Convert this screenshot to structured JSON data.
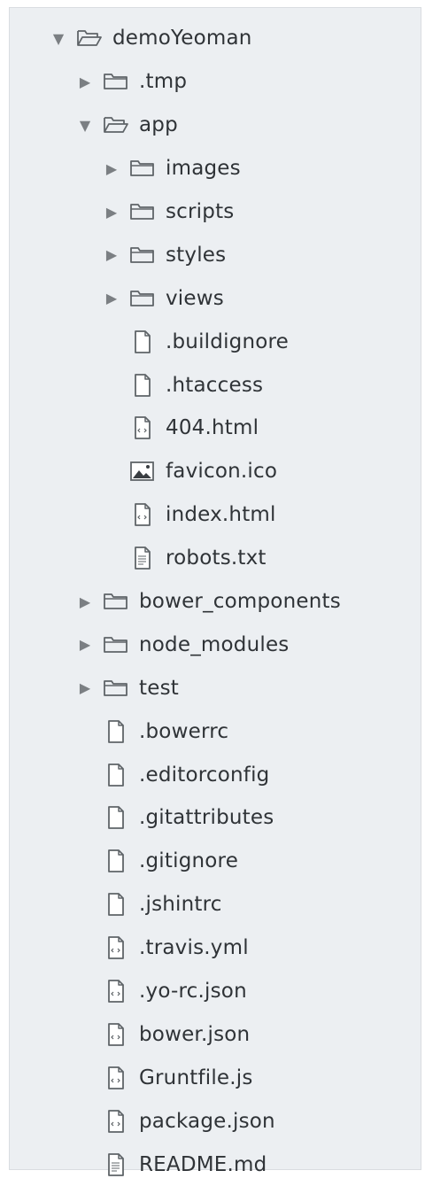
{
  "tree": [
    {
      "label": "demoYeoman",
      "kind": "folder",
      "state": "expanded",
      "depth": 0
    },
    {
      "label": ".tmp",
      "kind": "folder",
      "state": "collapsed",
      "depth": 1
    },
    {
      "label": "app",
      "kind": "folder",
      "state": "expanded",
      "depth": 1
    },
    {
      "label": "images",
      "kind": "folder",
      "state": "collapsed",
      "depth": 2
    },
    {
      "label": "scripts",
      "kind": "folder",
      "state": "collapsed",
      "depth": 2
    },
    {
      "label": "styles",
      "kind": "folder",
      "state": "collapsed",
      "depth": 2
    },
    {
      "label": "views",
      "kind": "folder",
      "state": "collapsed",
      "depth": 2
    },
    {
      "label": ".buildignore",
      "kind": "file",
      "icon": "file-icon",
      "depth": 2
    },
    {
      "label": ".htaccess",
      "kind": "file",
      "icon": "file-icon",
      "depth": 2
    },
    {
      "label": "404.html",
      "kind": "file",
      "icon": "code-file-icon",
      "depth": 2
    },
    {
      "label": "favicon.ico",
      "kind": "file",
      "icon": "image-file-icon",
      "depth": 2
    },
    {
      "label": "index.html",
      "kind": "file",
      "icon": "code-file-icon",
      "depth": 2
    },
    {
      "label": "robots.txt",
      "kind": "file",
      "icon": "text-file-icon",
      "depth": 2
    },
    {
      "label": "bower_components",
      "kind": "folder",
      "state": "collapsed",
      "depth": 1
    },
    {
      "label": "node_modules",
      "kind": "folder",
      "state": "collapsed",
      "depth": 1
    },
    {
      "label": "test",
      "kind": "folder",
      "state": "collapsed",
      "depth": 1
    },
    {
      "label": ".bowerrc",
      "kind": "file",
      "icon": "file-icon",
      "depth": 1
    },
    {
      "label": ".editorconfig",
      "kind": "file",
      "icon": "file-icon",
      "depth": 1
    },
    {
      "label": ".gitattributes",
      "kind": "file",
      "icon": "file-icon",
      "depth": 1
    },
    {
      "label": ".gitignore",
      "kind": "file",
      "icon": "file-icon",
      "depth": 1
    },
    {
      "label": ".jshintrc",
      "kind": "file",
      "icon": "file-icon",
      "depth": 1
    },
    {
      "label": ".travis.yml",
      "kind": "file",
      "icon": "code-file-icon",
      "depth": 1
    },
    {
      "label": ".yo-rc.json",
      "kind": "file",
      "icon": "code-file-icon",
      "depth": 1
    },
    {
      "label": "bower.json",
      "kind": "file",
      "icon": "code-file-icon",
      "depth": 1
    },
    {
      "label": "Gruntfile.js",
      "kind": "file",
      "icon": "code-file-icon",
      "depth": 1
    },
    {
      "label": "package.json",
      "kind": "file",
      "icon": "code-file-icon",
      "depth": 1
    },
    {
      "label": "README.md",
      "kind": "file",
      "icon": "text-file-icon",
      "depth": 1
    }
  ],
  "colors": {
    "panel_background": "#eceff2",
    "text": "#2f3337",
    "icon_stroke": "#5f6468",
    "arrow": "#7b7f83"
  }
}
